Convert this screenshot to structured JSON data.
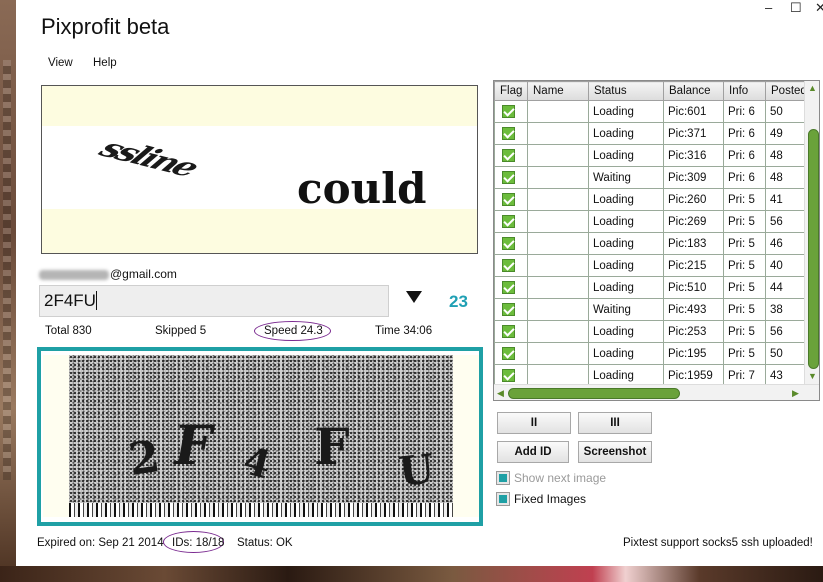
{
  "window": {
    "title": "Pixprofit beta",
    "controls": {
      "minimize": "–",
      "maximize": "☐",
      "close": "✕"
    }
  },
  "menu": {
    "items": [
      "View",
      "Help"
    ]
  },
  "captcha_top": {
    "word1": "ssline",
    "word2": "could"
  },
  "account": {
    "email_suffix": "@gmail.com"
  },
  "answer": {
    "value": "2F4FU",
    "counter": "23"
  },
  "stats": {
    "total": "Total 830",
    "skipped": "Skipped 5",
    "speed": "Speed 24.3",
    "time": "Time 34:06"
  },
  "captcha_bottom": {
    "glyphs": [
      "2",
      "F",
      "4",
      "F",
      "U"
    ]
  },
  "grid": {
    "columns": [
      "Flag",
      "Name",
      "Status",
      "Balance",
      "Info",
      "Posted"
    ],
    "rows": [
      {
        "status": "Loading",
        "balance": "Pic:601",
        "info": "Pri: 6",
        "posted": "50"
      },
      {
        "status": "Loading",
        "balance": "Pic:371",
        "info": "Pri: 6",
        "posted": "49"
      },
      {
        "status": "Loading",
        "balance": "Pic:316",
        "info": "Pri: 6",
        "posted": "48"
      },
      {
        "status": "Waiting",
        "balance": "Pic:309",
        "info": "Pri: 6",
        "posted": "48"
      },
      {
        "status": "Loading",
        "balance": "Pic:260",
        "info": "Pri: 5",
        "posted": "41"
      },
      {
        "status": "Loading",
        "balance": "Pic:269",
        "info": "Pri: 5",
        "posted": "56"
      },
      {
        "status": "Loading",
        "balance": "Pic:183",
        "info": "Pri: 5",
        "posted": "46"
      },
      {
        "status": "Loading",
        "balance": "Pic:215",
        "info": "Pri: 5",
        "posted": "40"
      },
      {
        "status": "Loading",
        "balance": "Pic:510",
        "info": "Pri: 5",
        "posted": "44"
      },
      {
        "status": "Waiting",
        "balance": "Pic:493",
        "info": "Pri: 5",
        "posted": "38"
      },
      {
        "status": "Loading",
        "balance": "Pic:253",
        "info": "Pri: 5",
        "posted": "56"
      },
      {
        "status": "Loading",
        "balance": "Pic:195",
        "info": "Pri: 5",
        "posted": "50"
      },
      {
        "status": "Loading",
        "balance": "Pic:1959",
        "info": "Pri: 7",
        "posted": "43"
      }
    ]
  },
  "buttons": {
    "pause": "II",
    "stop": "III",
    "add_id": "Add ID",
    "screenshot": "Screenshot"
  },
  "options": {
    "show_next_image": {
      "label": "Show next image",
      "checked": true,
      "enabled": false
    },
    "fixed_images": {
      "label": "Fixed Images",
      "checked": true,
      "enabled": true
    }
  },
  "footer": {
    "expired": "Expired on: Sep 21 2014",
    "ids": "IDs: 18/18",
    "status": "Status: OK",
    "message": "Pixtest support socks5  ssh uploaded!"
  },
  "colors": {
    "accent": "#1fa0a5",
    "counter": "#20a0b4",
    "check_green": "#6cbc3c",
    "oval": "#7a2a90"
  }
}
